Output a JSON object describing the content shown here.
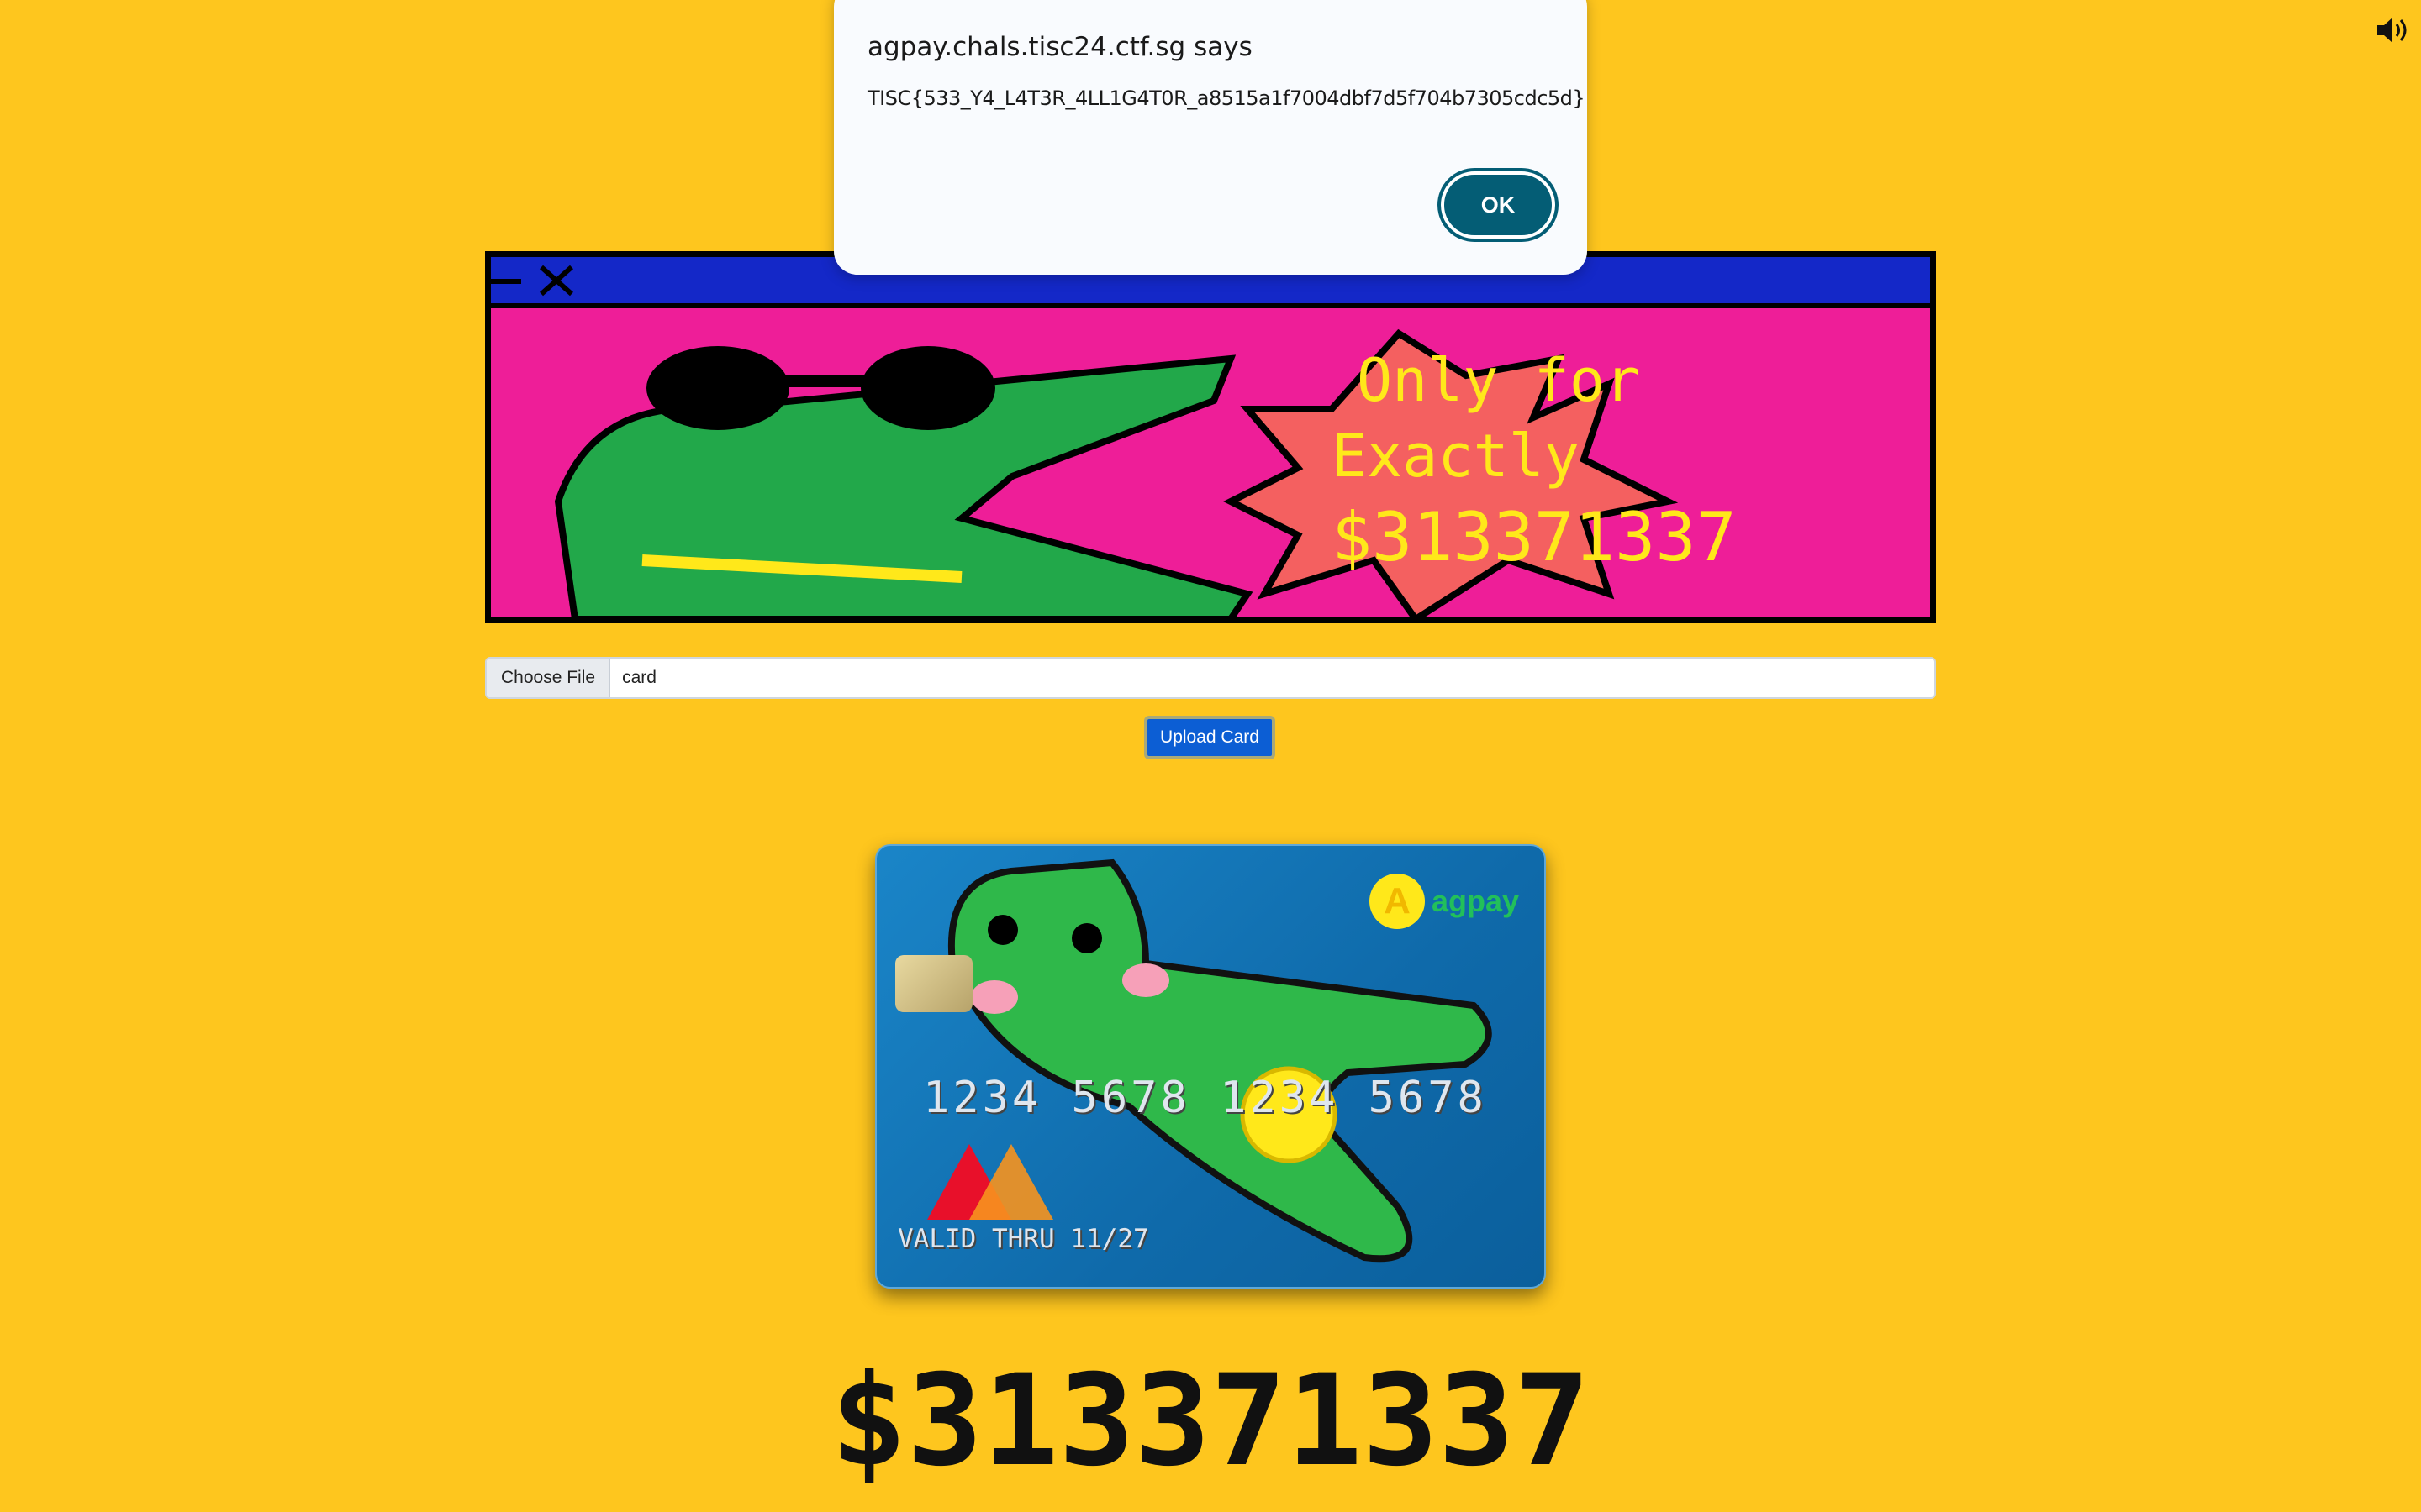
{
  "page": {
    "title": "AgPay"
  },
  "uploader": {
    "choose_label": "Choose File",
    "file_name": "card",
    "upload_label": "Upload Card"
  },
  "banner": {
    "text_lines": [
      "Only for",
      "Exactly",
      "$313371337"
    ]
  },
  "card": {
    "brand": "agpay",
    "coin_letter": "A",
    "number": "1234 5678 1234 5678",
    "valid": "VALID THRU 11/27"
  },
  "balance": "$313371337",
  "dialog": {
    "origin": "agpay.chals.tisc24.ctf.sg says",
    "message": "TISC{533_Y4_L4T3R_4LL1G4T0R_a8515a1f7004dbf7d5f704b7305cdc5d}",
    "ok_label": "OK"
  },
  "colors": {
    "background": "#fec61e",
    "button": "#0c5ed4",
    "dialog_button": "#045d75"
  }
}
